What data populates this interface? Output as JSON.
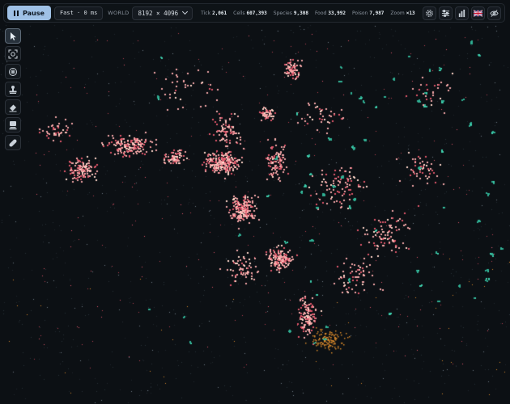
{
  "topbar": {
    "pause_label": "Pause",
    "speed": "Fast · 0 ms",
    "world_label": "WORLD",
    "world_size": "8192 × 4096",
    "stats": [
      {
        "label": "Tick",
        "value": "2,061"
      },
      {
        "label": "Cells",
        "value": "607,393"
      },
      {
        "label": "Species",
        "value": "9,308"
      },
      {
        "label": "Food",
        "value": "33,992"
      },
      {
        "label": "Poison",
        "value": "7,987"
      },
      {
        "label": "Zoom",
        "value": "×13"
      }
    ],
    "right_icons": [
      "settings-icon",
      "sliders-icon",
      "bar-chart-icon",
      "uk-flag-icon",
      "eye-hide-icon"
    ]
  },
  "tools": [
    {
      "name": "select-tool",
      "icon": "cursor-icon",
      "active": true
    },
    {
      "name": "focus-tool",
      "icon": "target-icon",
      "active": false
    },
    {
      "name": "spawn-tool",
      "icon": "organism-icon",
      "active": false
    },
    {
      "name": "stamp-tool",
      "icon": "stamp-icon",
      "active": false
    },
    {
      "name": "eraser-tool",
      "icon": "eraser-icon",
      "active": false
    },
    {
      "name": "wall-tool",
      "icon": "wall-icon",
      "active": false
    },
    {
      "name": "pill-tool",
      "icon": "pill-icon",
      "active": false
    }
  ],
  "colors": {
    "background": "#0c1014",
    "cell_pink": "#f3a6a6",
    "cell_red": "#e0566a",
    "species_teal": "#2fae92",
    "food_orange": "#d8882a",
    "poison_grey": "#6f7a86",
    "accent": "#9fc1e6"
  }
}
